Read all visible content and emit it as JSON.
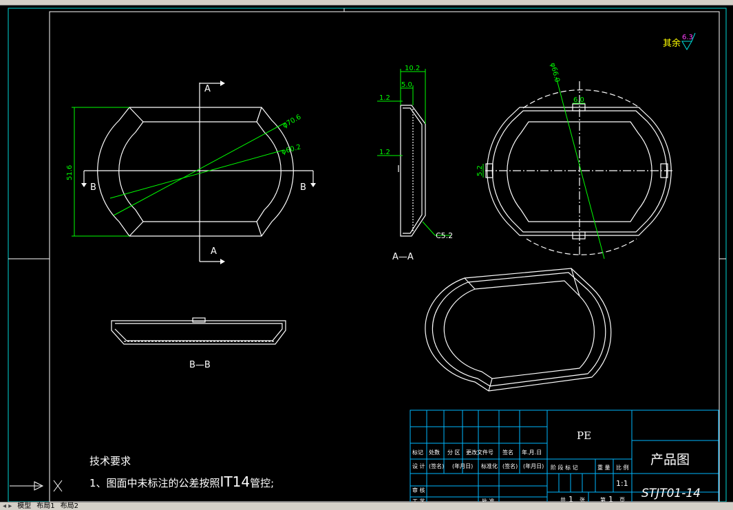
{
  "drawing": {
    "section_mark_a": "A",
    "section_mark_b": "B",
    "dim_51_6": "51.6",
    "dim_70_6": "φ70.6",
    "dim_60_2": "φ60.2",
    "dim_10_2": "10.2",
    "dim_5_0": "5.0",
    "dim_1_2_top": "1.2",
    "dim_1_2_mid": "1.2",
    "dim_c5_2": "C5.2",
    "view_aa_label": "A—A",
    "dim_66_0": "φ66.0",
    "dim_6_0": "6.0",
    "dim_5_2": "5.2",
    "view_bb_label": "B—B",
    "roughness_prefix": "其余",
    "roughness_value": "6.3",
    "tech_title": "技术要求",
    "tech_note_1_prefix": "1、图面中未标注的公差按照",
    "tech_note_1_grade": "IT14",
    "tech_note_1_suffix": "管控;"
  },
  "title_block": {
    "material": "PE",
    "title": "产品图",
    "drawing_number": "STJT01-14",
    "scale": "1:1",
    "sheet_total": "1",
    "sheet_index": "1",
    "h_mark": "标记",
    "h_count": "处数",
    "h_zone": "分 区",
    "h_change_doc": "更改文件号",
    "h_sign": "签名",
    "h_date": "年.月.日",
    "h_design": "设 计",
    "h_sign2": "(签名)",
    "h_date2": "(年月日)",
    "h_std": "标准化",
    "h_sign3": "(签名)",
    "h_date3": "(年月日)",
    "h_stage": "阶 段 标 记",
    "h_weight": "重 量",
    "h_ratio": "比 例",
    "h_review": "审 核",
    "h_process": "工 艺",
    "h_approve": "批 准",
    "h_total_pre": "共",
    "h_total_post": "张",
    "h_page_pre": "第",
    "h_page_post": "页"
  },
  "tabs": {
    "model": "模型",
    "layout1": "布局1",
    "layout2": "布局2"
  },
  "colors": {
    "background": "#000000",
    "geometry": "#ffffff",
    "dimension": "#00ff00",
    "frame": "#00d8d8",
    "table": "#00b8ff",
    "roughness_text": "#ffff00",
    "roughness_symbol": "#00e0e0",
    "roughness_value": "#ff40ff"
  }
}
